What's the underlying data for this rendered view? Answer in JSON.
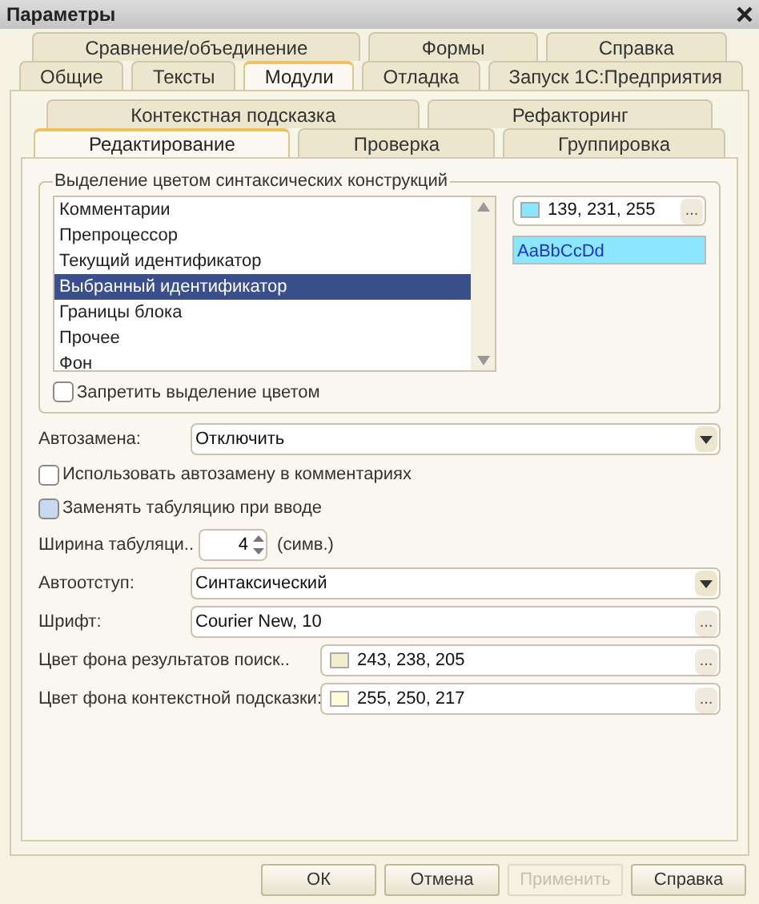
{
  "window": {
    "title": "Параметры"
  },
  "tab_rows": [
    [
      {
        "label": "Сравнение/объединение",
        "selected": false
      },
      {
        "label": "Формы",
        "selected": false
      },
      {
        "label": "Справка",
        "selected": false
      }
    ],
    [
      {
        "label": "Общие",
        "selected": false
      },
      {
        "label": "Тексты",
        "selected": false
      },
      {
        "label": "Модули",
        "selected": true
      },
      {
        "label": "Отладка",
        "selected": false
      },
      {
        "label": "Запуск 1С:Предприятия",
        "selected": false
      }
    ]
  ],
  "subtab_rows": [
    [
      {
        "label": "Контекстная подсказка",
        "selected": false
      },
      {
        "label": "Рефакторинг",
        "selected": false
      }
    ],
    [
      {
        "label": "Редактирование",
        "selected": true
      },
      {
        "label": "Проверка",
        "selected": false
      },
      {
        "label": "Группировка",
        "selected": false
      }
    ]
  ],
  "highlight_group": {
    "title": "Выделение цветом синтаксических конструкций",
    "items": [
      {
        "label": "Комментарии",
        "selected": false
      },
      {
        "label": "Препроцессор",
        "selected": false
      },
      {
        "label": "Текущий идентификатор",
        "selected": false
      },
      {
        "label": "Выбранный идентификатор",
        "selected": true
      },
      {
        "label": "Границы блока",
        "selected": false
      },
      {
        "label": "Прочее",
        "selected": false
      },
      {
        "label": "Фон",
        "selected": false
      }
    ],
    "color_value": "139, 231, 255",
    "color": "#8be7ff",
    "button": "...",
    "preview": "AaBbCcDd",
    "disable_checkbox": {
      "label": "Запретить выделение цветом",
      "checked": false
    }
  },
  "fields": [
    {
      "kind": "select",
      "label": "Автозамена:",
      "value": "Отключить"
    },
    {
      "kind": "checkbox",
      "label": "Использовать автозамену в комментариях",
      "checked": false,
      "highlighted": false
    },
    {
      "kind": "checkbox",
      "label": "Заменять табуляцию при вводе",
      "checked": false,
      "highlighted": true
    },
    {
      "kind": "spin",
      "label": "Ширина табуляци..",
      "value": "4",
      "unit": "(симв.)"
    },
    {
      "kind": "select",
      "label": "Автоотступ:",
      "value": "Синтаксический"
    },
    {
      "kind": "picker",
      "label": "Шрифт:",
      "value": "Courier New, 10",
      "button": "..."
    },
    {
      "kind": "color",
      "label": "Цвет фона результатов поиск..",
      "value": "243, 238, 205",
      "color": "#f3eecd",
      "button": "..."
    },
    {
      "kind": "color",
      "label": "Цвет фона контекстной подсказки:",
      "value": "255, 250, 217",
      "color": "#fffad9",
      "button": "..."
    }
  ],
  "buttons": [
    {
      "label": "ОК",
      "disabled": false
    },
    {
      "label": "Отмена",
      "disabled": false
    },
    {
      "label": "Применить",
      "disabled": true
    },
    {
      "label": "Справка",
      "disabled": false
    }
  ]
}
